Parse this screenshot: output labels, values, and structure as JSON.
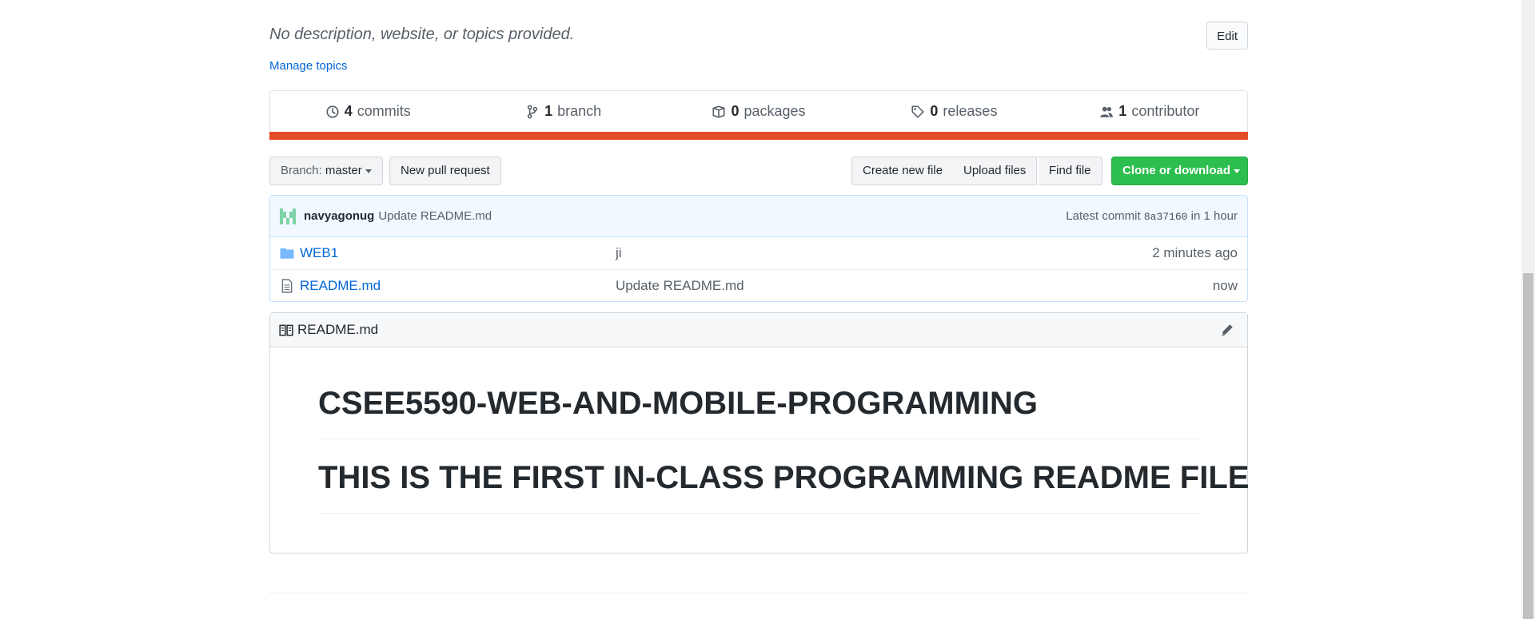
{
  "repo": {
    "description": "No description, website, or topics provided.",
    "manage_topics": "Manage topics",
    "edit_label": "Edit"
  },
  "stats": {
    "commits_count": "4",
    "commits_label": "commits",
    "branch_count": "1",
    "branch_label": "branch",
    "packages_count": "0",
    "packages_label": "packages",
    "releases_count": "0",
    "releases_label": "releases",
    "contributor_count": "1",
    "contributor_label": "contributor",
    "language_bar_color": "#e34c26"
  },
  "toolbar": {
    "branch_prefix": "Branch:",
    "branch_name": "master",
    "new_pull_request": "New pull request",
    "create_new_file": "Create new file",
    "upload_files": "Upload files",
    "find_file": "Find file",
    "clone_or_download": "Clone or download"
  },
  "latest_commit": {
    "author": "navyagonug",
    "message": "Update README.md",
    "prefix": "Latest commit",
    "sha": "8a37160",
    "age": "in 1 hour"
  },
  "files": [
    {
      "icon": "folder-icon",
      "name": "WEB1",
      "message": "ji",
      "age": "2 minutes ago"
    },
    {
      "icon": "file-icon",
      "name": "README.md",
      "message": "Update README.md",
      "age": "now"
    }
  ],
  "readme": {
    "title": "README.md",
    "headings": [
      "CSEE5590-WEB-AND-MOBILE-PROGRAMMING",
      "THIS IS THE FIRST IN-CLASS PROGRAMMING README FILE"
    ]
  }
}
